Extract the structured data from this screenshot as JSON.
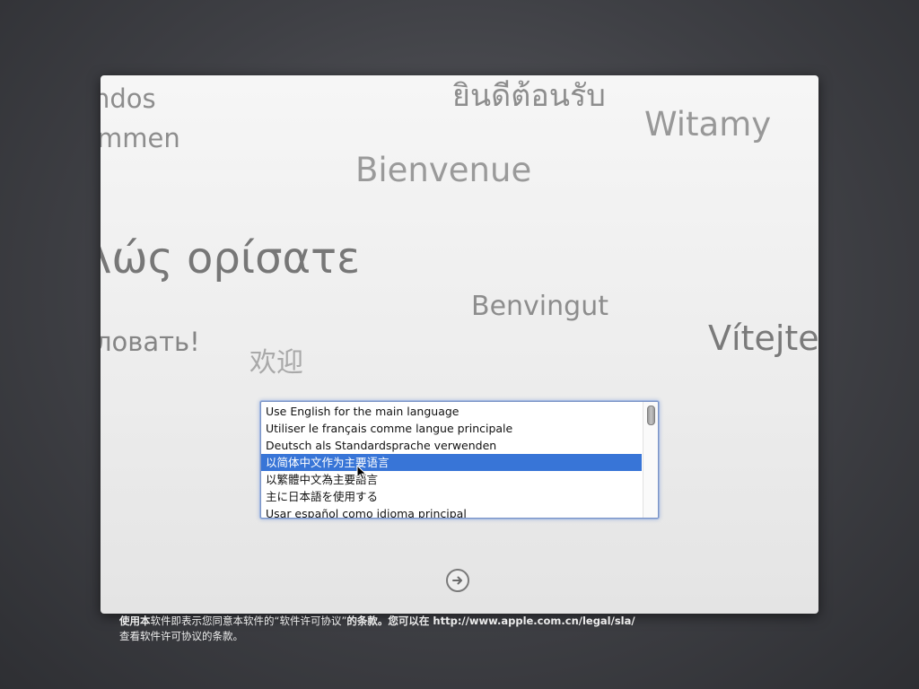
{
  "welcome_words": [
    {
      "text": "ndos"
    },
    {
      "text": "mmen"
    },
    {
      "text": "ยินดีต้อนรับ"
    },
    {
      "text": "Witamy"
    },
    {
      "text": "Bienvenue"
    },
    {
      "text": "λώς ορίσατε"
    },
    {
      "text": "Benvingut"
    },
    {
      "text": "ловать!"
    },
    {
      "text": "Vítejte"
    },
    {
      "text": "欢迎"
    }
  ],
  "language_list": {
    "items": [
      "Use English for the main language",
      "Utiliser le français comme langue principale",
      "Deutsch als Standardsprache verwenden",
      "以简体中文作为主要语言",
      "以繁體中文為主要語言",
      "主に日本語を使用する",
      "Usar español como idioma principal"
    ],
    "selected_index": 3
  },
  "continue_button": {
    "icon": "right-arrow-circle-icon"
  },
  "footer": {
    "part1": "使用本",
    "part2": "软件即表示您同意本软件的“软件许可协议”",
    "part3": "的条款。您可以在 http://www.apple.com.cn/legal/sla/",
    "line2": "查看软件许可协议的条款。"
  },
  "colors": {
    "selection": "#3875d7",
    "welcome_text": "#8d8d8d",
    "list_focus_ring": "#7a93c6"
  }
}
